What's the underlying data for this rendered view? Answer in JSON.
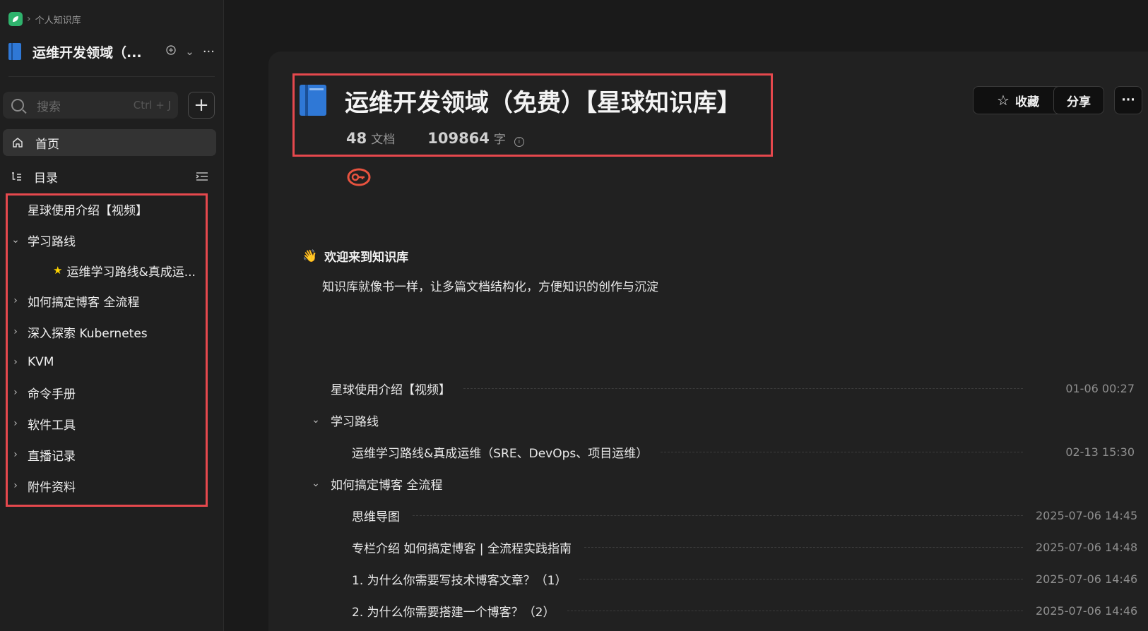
{
  "colors": {
    "accent_red": "#e5484d",
    "brand_green": "#2fb36d",
    "book_blue": "#2f78d6",
    "key_orange": "#e8533f"
  },
  "breadcrumb": {
    "item": "个人知识库"
  },
  "sidebar": {
    "book_title": "运维开发领域（...",
    "search": {
      "placeholder": "搜索",
      "shortcut": "Ctrl + J"
    },
    "home_label": "首页",
    "toc_label": "目录",
    "toc": [
      {
        "label": "星球使用介绍【视频】",
        "expandable": false
      },
      {
        "label": "学习路线",
        "expandable": true,
        "expanded": true
      },
      {
        "label": "运维学习路线&真成运...",
        "child": true,
        "starred": true
      },
      {
        "label": "如何搞定博客 全流程",
        "expandable": true,
        "expanded": false
      },
      {
        "label": "深入探索 Kubernetes",
        "expandable": true,
        "expanded": false
      },
      {
        "label": "KVM",
        "expandable": true,
        "expanded": false
      },
      {
        "label": "命令手册",
        "expandable": true,
        "expanded": false
      },
      {
        "label": "软件工具",
        "expandable": true,
        "expanded": false
      },
      {
        "label": "直播记录",
        "expandable": true,
        "expanded": false
      },
      {
        "label": "附件资料",
        "expandable": true,
        "expanded": false
      }
    ]
  },
  "header": {
    "title": "运维开发领域（免费）【星球知识库】",
    "doc_count": "48",
    "doc_unit": "文档",
    "word_count": "109864",
    "word_unit": "字",
    "collect_label": "收藏",
    "share_label": "分享",
    "more_label": "···"
  },
  "welcome": {
    "emoji": "👋",
    "title": "欢迎来到知识库",
    "desc": "知识库就像书一样，让多篇文档结构化，方便知识的创作与沉淀"
  },
  "docs": [
    {
      "title": "星球使用介绍【视频】",
      "date": "01-06 00:27"
    },
    {
      "title": "学习路线",
      "folder": true
    },
    {
      "title": "运维学习路线&真成运维（SRE、DevOps、项目运维）",
      "date": "02-13 15:30",
      "child": true
    },
    {
      "title": "如何搞定博客 全流程",
      "folder": true
    },
    {
      "title": "思维导图",
      "date": "2025-07-06 14:45",
      "child": true
    },
    {
      "title": "专栏介绍 如何搞定博客 | 全流程实践指南",
      "date": "2025-07-06 14:48",
      "child": true
    },
    {
      "title": "1. 为什么你需要写技术博客文章？（1）",
      "date": "2025-07-06 14:46",
      "child": true
    },
    {
      "title": "2. 为什么你需要搭建一个博客？（2）",
      "date": "2025-07-06 14:46",
      "child": true
    }
  ]
}
